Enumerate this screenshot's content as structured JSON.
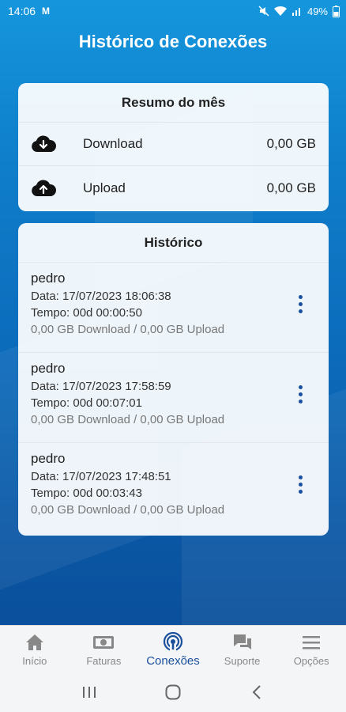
{
  "status_bar": {
    "time": "14:06",
    "carrier_icon": "M",
    "battery": "49%",
    "icons": [
      "mute-icon",
      "wifi-icon",
      "signal-icon",
      "battery-icon"
    ]
  },
  "header": {
    "title": "Histórico de Conexões"
  },
  "summary": {
    "title": "Resumo do mês",
    "rows": [
      {
        "icon": "cloud-download-icon",
        "label": "Download",
        "value": "0,00 GB"
      },
      {
        "icon": "cloud-upload-icon",
        "label": "Upload",
        "value": "0,00 GB"
      }
    ]
  },
  "history": {
    "title": "Histórico",
    "items": [
      {
        "name": "pedro",
        "date": "Data: 17/07/2023 18:06:38",
        "time": "Tempo: 00d 00:00:50",
        "traffic": "0,00 GB Download / 0,00 GB Upload"
      },
      {
        "name": "pedro",
        "date": "Data: 17/07/2023 17:58:59",
        "time": "Tempo: 00d 00:07:01",
        "traffic": "0,00 GB Download / 0,00 GB Upload"
      },
      {
        "name": "pedro",
        "date": "Data: 17/07/2023 17:48:51",
        "time": "Tempo: 00d 00:03:43",
        "traffic": "0,00 GB Download / 0,00 GB Upload"
      }
    ]
  },
  "bottom_nav": {
    "items": [
      {
        "label": "Início",
        "icon": "home-icon"
      },
      {
        "label": "Faturas",
        "icon": "money-icon"
      },
      {
        "label": "Conexões",
        "icon": "broadcast-icon",
        "active": true
      },
      {
        "label": "Suporte",
        "icon": "chat-icon"
      },
      {
        "label": "Opções",
        "icon": "menu-icon"
      }
    ]
  },
  "colors": {
    "accent": "#1a4f9b",
    "background_top": "#1596dc",
    "background_bottom": "#0a4f9b"
  }
}
